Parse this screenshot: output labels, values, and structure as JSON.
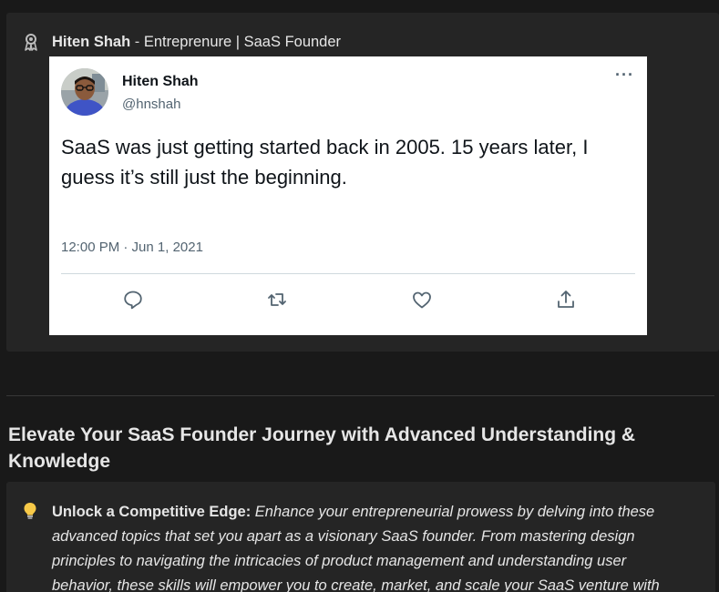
{
  "author": {
    "name": "Hiten Shah",
    "separator": " - ",
    "title": "Entreprenure | SaaS Founder"
  },
  "tweet": {
    "display_name": "Hiten Shah",
    "handle": "@hnshah",
    "more_label": "···",
    "text": "SaaS was just getting started back in 2005. 15 years later, I guess it’s still just the beginning.",
    "timestamp": "12:00 PM · Jun 1, 2021",
    "actions": [
      "reply-icon",
      "retweet-icon",
      "like-icon",
      "share-icon"
    ]
  },
  "section": {
    "heading": "Elevate Your SaaS Founder Journey with Advanced Understanding & Knowledge"
  },
  "callout": {
    "icon": "lightbulb-icon",
    "lead": "Unlock a Competitive Edge",
    "colon": ":",
    "text": " Enhance your entrepreneurial prowess by delving into these advanced topics that set you apart as a visionary SaaS founder. From mastering design principles to navigating the intricacies of product management and understanding user behavior, these skills will empower you to create, market, and scale your SaaS venture with"
  },
  "colors": {
    "background": "#191919",
    "callout_bg": "#252525",
    "tweet_bg": "#ffffff",
    "tweet_secondary": "#536471",
    "text_light": "#e6e6e6"
  }
}
